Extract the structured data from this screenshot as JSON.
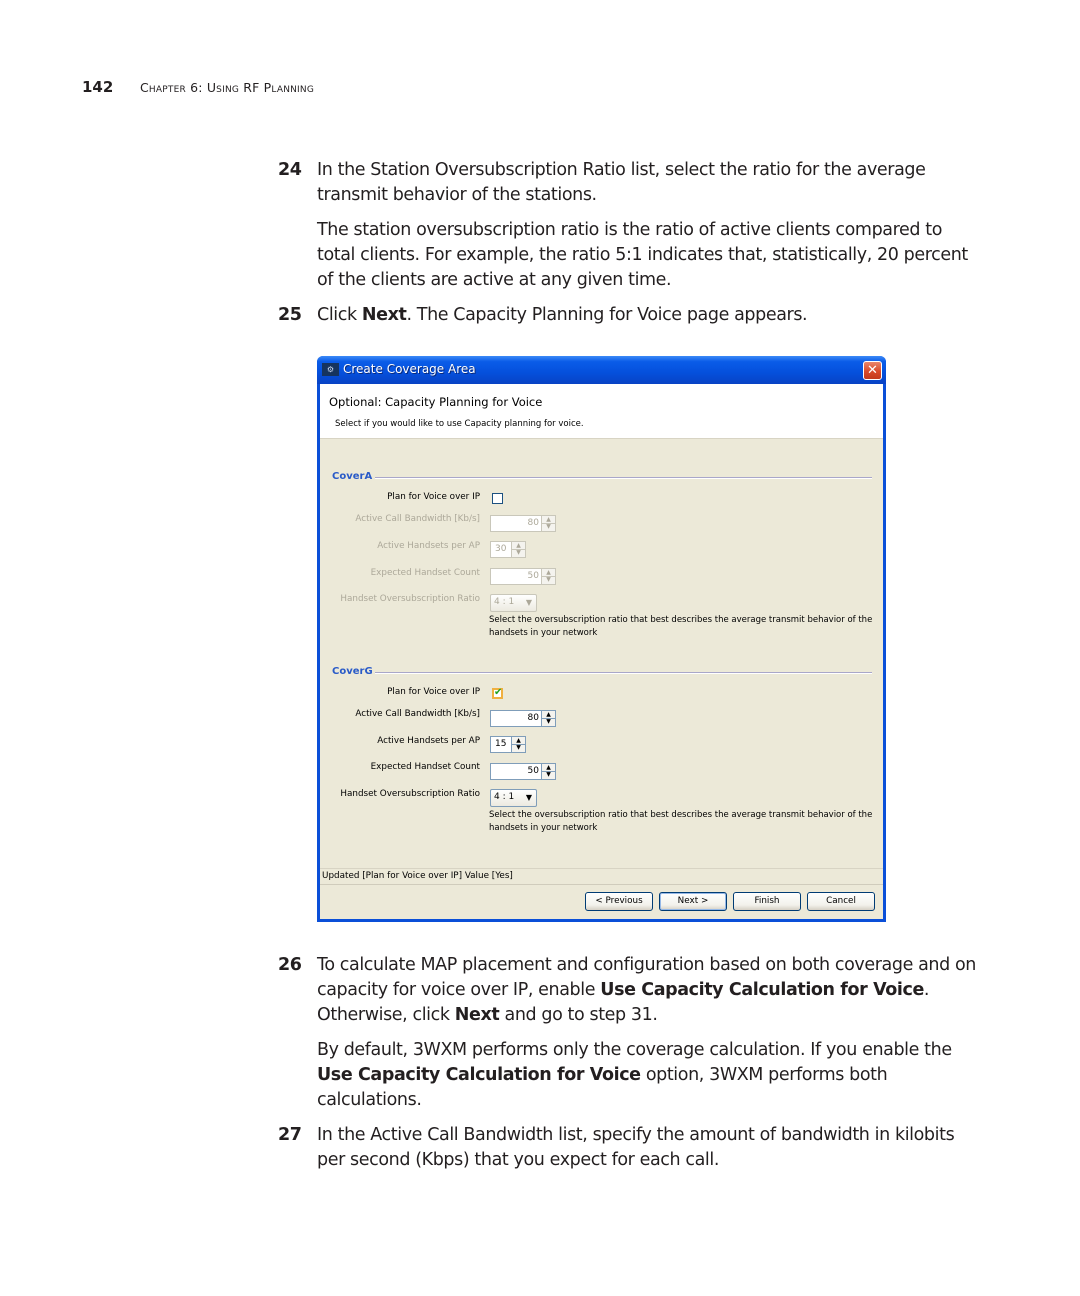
{
  "running_head": {
    "page_number": "142",
    "chapter": "Chapter 6: Using RF Planning"
  },
  "steps": {
    "s24": {
      "number": "24",
      "text": "In the Station Oversubscription Ratio list, select the ratio for the average transmit behavior of the stations.",
      "note": "The station oversubscription ratio is the ratio of active clients compared to total clients. For example, the ratio 5:1 indicates that, statistically, 20 percent of the clients are active at any given time."
    },
    "s25": {
      "number": "25",
      "pre": "Click ",
      "bold": "Next",
      "post": ". The Capacity Planning for Voice page appears."
    },
    "s26": {
      "number": "26",
      "pre": "To calculate MAP placement and configuration based on both coverage and on capacity for voice over IP, enable ",
      "bold1": "Use Capacity Calculation for Voice",
      "mid": ". Otherwise, click ",
      "bold2": "Next",
      "post": " and go to step 31.",
      "note_pre": "By default, 3WXM performs only the coverage calculation. If you enable the ",
      "note_bold": "Use Capacity Calculation for Voice",
      "note_post": " option, 3WXM performs both calculations."
    },
    "s27": {
      "number": "27",
      "text": "In the Active Call Bandwidth list, specify the amount of bandwidth in kilobits per second (Kbps) that you expect for each call."
    }
  },
  "dialog": {
    "title": "Create Coverage Area",
    "app_icon": "app-icon",
    "close_label": "✕",
    "header_title": "Optional: Capacity Planning for Voice",
    "header_subtitle": "Select if you would like to use Capacity planning for voice.",
    "groups": {
      "a": {
        "name": "CoverA",
        "enabled": false,
        "plan_voip_label": "Plan for Voice over IP",
        "plan_voip_checked": false,
        "bandwidth_label": "Active Call Bandwidth [Kb/s]",
        "bandwidth_value": "80",
        "handsets_per_ap_label": "Active Handsets per AP",
        "handsets_per_ap_value": "30",
        "handset_count_label": "Expected Handset Count",
        "handset_count_value": "50",
        "ratio_label": "Handset Oversubscription Ratio",
        "ratio_value": "4 : 1",
        "help": "Select the oversubscription ratio that best describes the average transmit behavior of the handsets in your network"
      },
      "g": {
        "name": "CoverG",
        "enabled": true,
        "plan_voip_label": "Plan for Voice over IP",
        "plan_voip_checked": true,
        "bandwidth_label": "Active Call Bandwidth [Kb/s]",
        "bandwidth_value": "80",
        "handsets_per_ap_label": "Active Handsets per AP",
        "handsets_per_ap_value": "15",
        "handset_count_label": "Expected Handset Count",
        "handset_count_value": "50",
        "ratio_label": "Handset Oversubscription Ratio",
        "ratio_value": "4 : 1",
        "help": "Select the oversubscription ratio that best describes the average transmit behavior of the handsets in your network"
      }
    },
    "status": "Updated [Plan for Voice over IP] Value [Yes]",
    "buttons": {
      "previous": "< Previous",
      "next": "Next >",
      "finish": "Finish",
      "cancel": "Cancel"
    },
    "glyphs": {
      "check": "✔",
      "up": "▲",
      "down": "▼",
      "dropdown": "▼"
    }
  }
}
